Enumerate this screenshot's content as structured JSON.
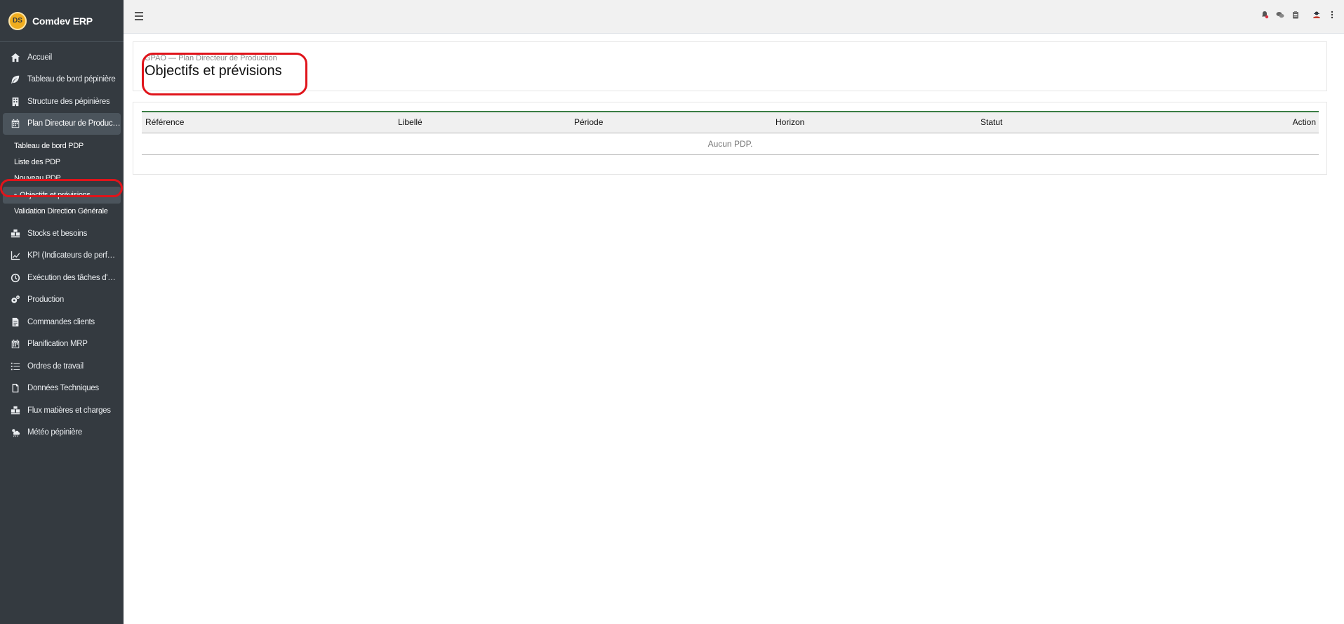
{
  "brand": {
    "name": "Comdev ERP",
    "logo_text": "DS"
  },
  "sidebar": {
    "items": [
      {
        "label": "Accueil",
        "icon": "home-icon"
      },
      {
        "label": "Tableau de bord pépinière",
        "icon": "leaf-icon"
      },
      {
        "label": "Structure des pépinières",
        "icon": "building-icon"
      },
      {
        "label": "Plan Directeur de Production",
        "icon": "calendar-icon"
      }
    ],
    "submenu": [
      {
        "label": "Tableau de bord PDP"
      },
      {
        "label": "Liste des PDP"
      },
      {
        "label": "Nouveau PDP"
      },
      {
        "label": "Objectifs et prévisions"
      },
      {
        "label": "Validation Direction Générale"
      }
    ],
    "items_after": [
      {
        "label": "Stocks et besoins",
        "icon": "boxes-icon"
      },
      {
        "label": "KPI (Indicateurs de perf…",
        "icon": "chart-line-icon"
      },
      {
        "label": "Exécution des tâches d'…",
        "icon": "clock-icon"
      },
      {
        "label": "Production",
        "icon": "cogs-icon"
      },
      {
        "label": "Commandes clients",
        "icon": "file-invoice-icon"
      },
      {
        "label": "Planification MRP",
        "icon": "calendar-icon"
      },
      {
        "label": "Ordres de travail",
        "icon": "tasks-icon"
      },
      {
        "label": "Données Techniques",
        "icon": "file-icon"
      },
      {
        "label": "Flux matières et charges",
        "icon": "truck-loading-icon"
      },
      {
        "label": "Météo pépinière",
        "icon": "cloud-sun-icon"
      }
    ]
  },
  "topbar": {
    "icons": [
      "notification-icon",
      "chat-icon",
      "clipboard-icon",
      "user-avatar-icon",
      "more-vertical-icon"
    ]
  },
  "header": {
    "breadcrumb": "GPAO — Plan Directeur de Production",
    "title": "Objectifs et prévisions"
  },
  "table": {
    "columns": [
      "Référence",
      "Libellé",
      "Période",
      "Horizon",
      "Statut",
      "Action"
    ],
    "empty_message": "Aucun PDP."
  },
  "colors": {
    "sidebar_bg": "#343a40",
    "accent": "#3a7d44",
    "highlight": "#e0141b"
  }
}
